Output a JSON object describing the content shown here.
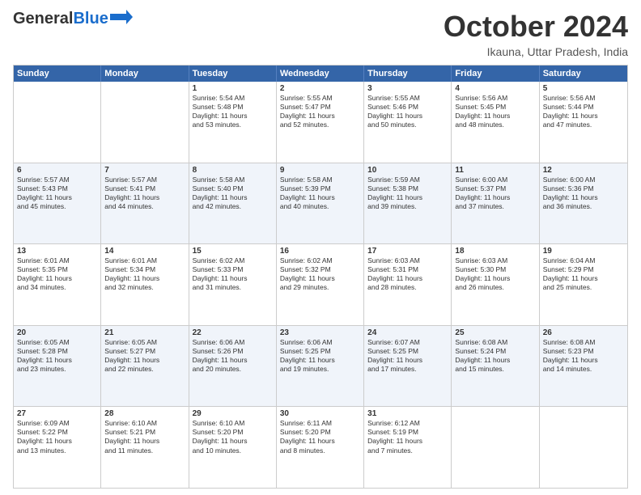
{
  "header": {
    "logo_general": "General",
    "logo_blue": "Blue",
    "month_title": "October 2024",
    "location": "Ikauna, Uttar Pradesh, India"
  },
  "calendar": {
    "days": [
      "Sunday",
      "Monday",
      "Tuesday",
      "Wednesday",
      "Thursday",
      "Friday",
      "Saturday"
    ],
    "rows": [
      [
        {
          "day": "",
          "text": ""
        },
        {
          "day": "",
          "text": ""
        },
        {
          "day": "1",
          "text": "Sunrise: 5:54 AM\nSunset: 5:48 PM\nDaylight: 11 hours\nand 53 minutes."
        },
        {
          "day": "2",
          "text": "Sunrise: 5:55 AM\nSunset: 5:47 PM\nDaylight: 11 hours\nand 52 minutes."
        },
        {
          "day": "3",
          "text": "Sunrise: 5:55 AM\nSunset: 5:46 PM\nDaylight: 11 hours\nand 50 minutes."
        },
        {
          "day": "4",
          "text": "Sunrise: 5:56 AM\nSunset: 5:45 PM\nDaylight: 11 hours\nand 48 minutes."
        },
        {
          "day": "5",
          "text": "Sunrise: 5:56 AM\nSunset: 5:44 PM\nDaylight: 11 hours\nand 47 minutes."
        }
      ],
      [
        {
          "day": "6",
          "text": "Sunrise: 5:57 AM\nSunset: 5:43 PM\nDaylight: 11 hours\nand 45 minutes."
        },
        {
          "day": "7",
          "text": "Sunrise: 5:57 AM\nSunset: 5:41 PM\nDaylight: 11 hours\nand 44 minutes."
        },
        {
          "day": "8",
          "text": "Sunrise: 5:58 AM\nSunset: 5:40 PM\nDaylight: 11 hours\nand 42 minutes."
        },
        {
          "day": "9",
          "text": "Sunrise: 5:58 AM\nSunset: 5:39 PM\nDaylight: 11 hours\nand 40 minutes."
        },
        {
          "day": "10",
          "text": "Sunrise: 5:59 AM\nSunset: 5:38 PM\nDaylight: 11 hours\nand 39 minutes."
        },
        {
          "day": "11",
          "text": "Sunrise: 6:00 AM\nSunset: 5:37 PM\nDaylight: 11 hours\nand 37 minutes."
        },
        {
          "day": "12",
          "text": "Sunrise: 6:00 AM\nSunset: 5:36 PM\nDaylight: 11 hours\nand 36 minutes."
        }
      ],
      [
        {
          "day": "13",
          "text": "Sunrise: 6:01 AM\nSunset: 5:35 PM\nDaylight: 11 hours\nand 34 minutes."
        },
        {
          "day": "14",
          "text": "Sunrise: 6:01 AM\nSunset: 5:34 PM\nDaylight: 11 hours\nand 32 minutes."
        },
        {
          "day": "15",
          "text": "Sunrise: 6:02 AM\nSunset: 5:33 PM\nDaylight: 11 hours\nand 31 minutes."
        },
        {
          "day": "16",
          "text": "Sunrise: 6:02 AM\nSunset: 5:32 PM\nDaylight: 11 hours\nand 29 minutes."
        },
        {
          "day": "17",
          "text": "Sunrise: 6:03 AM\nSunset: 5:31 PM\nDaylight: 11 hours\nand 28 minutes."
        },
        {
          "day": "18",
          "text": "Sunrise: 6:03 AM\nSunset: 5:30 PM\nDaylight: 11 hours\nand 26 minutes."
        },
        {
          "day": "19",
          "text": "Sunrise: 6:04 AM\nSunset: 5:29 PM\nDaylight: 11 hours\nand 25 minutes."
        }
      ],
      [
        {
          "day": "20",
          "text": "Sunrise: 6:05 AM\nSunset: 5:28 PM\nDaylight: 11 hours\nand 23 minutes."
        },
        {
          "day": "21",
          "text": "Sunrise: 6:05 AM\nSunset: 5:27 PM\nDaylight: 11 hours\nand 22 minutes."
        },
        {
          "day": "22",
          "text": "Sunrise: 6:06 AM\nSunset: 5:26 PM\nDaylight: 11 hours\nand 20 minutes."
        },
        {
          "day": "23",
          "text": "Sunrise: 6:06 AM\nSunset: 5:25 PM\nDaylight: 11 hours\nand 19 minutes."
        },
        {
          "day": "24",
          "text": "Sunrise: 6:07 AM\nSunset: 5:25 PM\nDaylight: 11 hours\nand 17 minutes."
        },
        {
          "day": "25",
          "text": "Sunrise: 6:08 AM\nSunset: 5:24 PM\nDaylight: 11 hours\nand 15 minutes."
        },
        {
          "day": "26",
          "text": "Sunrise: 6:08 AM\nSunset: 5:23 PM\nDaylight: 11 hours\nand 14 minutes."
        }
      ],
      [
        {
          "day": "27",
          "text": "Sunrise: 6:09 AM\nSunset: 5:22 PM\nDaylight: 11 hours\nand 13 minutes."
        },
        {
          "day": "28",
          "text": "Sunrise: 6:10 AM\nSunset: 5:21 PM\nDaylight: 11 hours\nand 11 minutes."
        },
        {
          "day": "29",
          "text": "Sunrise: 6:10 AM\nSunset: 5:20 PM\nDaylight: 11 hours\nand 10 minutes."
        },
        {
          "day": "30",
          "text": "Sunrise: 6:11 AM\nSunset: 5:20 PM\nDaylight: 11 hours\nand 8 minutes."
        },
        {
          "day": "31",
          "text": "Sunrise: 6:12 AM\nSunset: 5:19 PM\nDaylight: 11 hours\nand 7 minutes."
        },
        {
          "day": "",
          "text": ""
        },
        {
          "day": "",
          "text": ""
        }
      ]
    ]
  }
}
